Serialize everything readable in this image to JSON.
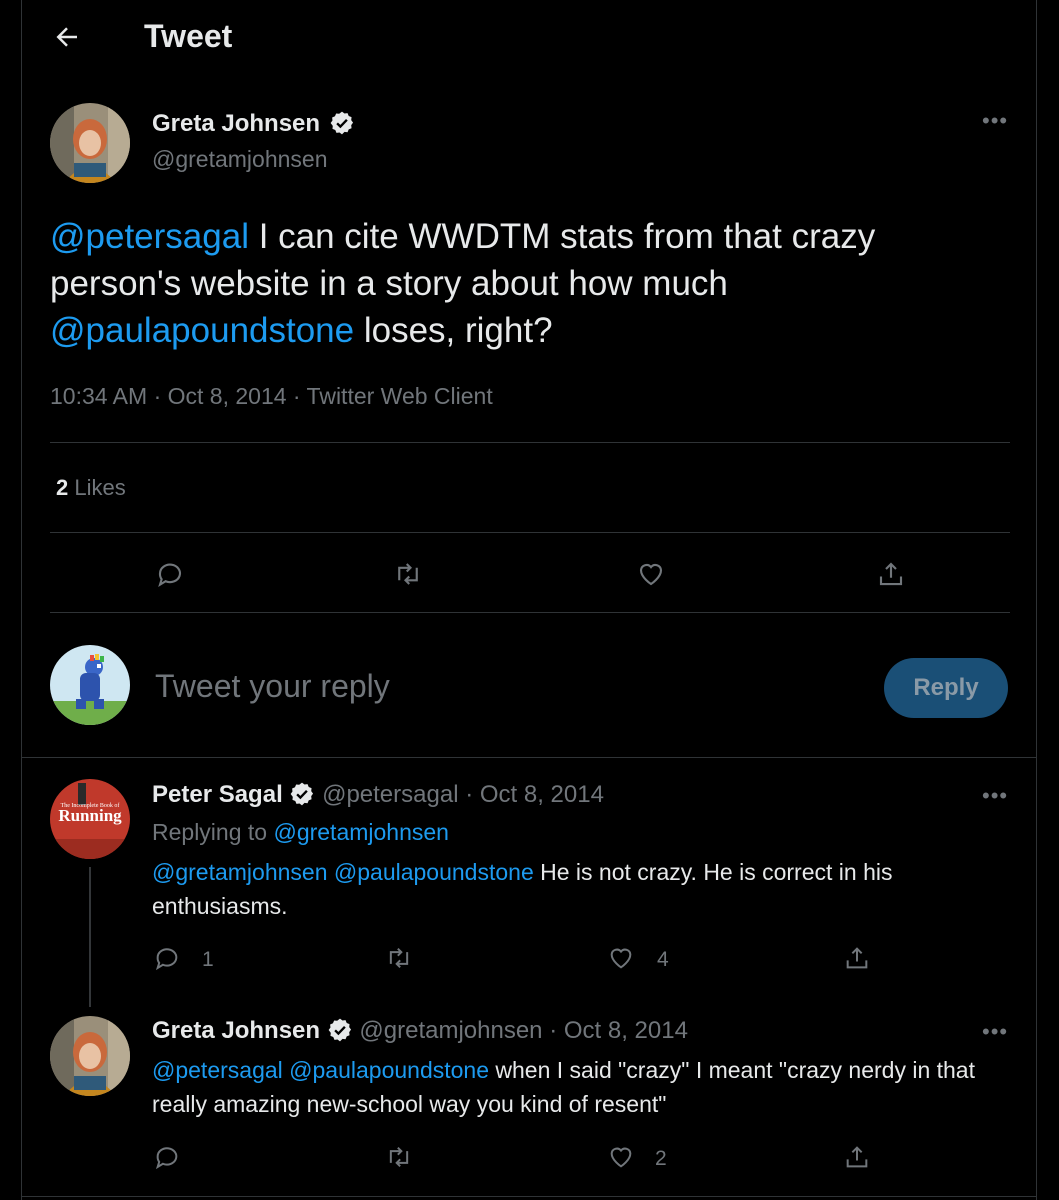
{
  "header": {
    "title": "Tweet"
  },
  "main_tweet": {
    "author_name": "Greta Johnsen",
    "author_handle": "@gretamjohnsen",
    "text_mention1": "@petersagal",
    "text_part1": " I can cite WWDTM stats from that crazy person's website in a story about how much ",
    "text_mention2": "@paulapoundstone",
    "text_part2": " loses, right?",
    "meta": "10:34 AM · Oct 8, 2014 · Twitter Web Client",
    "likes_count": "2",
    "likes_label": " Likes"
  },
  "composer": {
    "placeholder": "Tweet your reply",
    "reply_label": "Reply"
  },
  "replies": [
    {
      "author_name": "Peter Sagal",
      "author_meta": "@petersagal · Oct 8, 2014",
      "replying_prefix": "Replying to ",
      "replying_handle": "@gretamjohnsen",
      "mention1": "@gretamjohnsen",
      "mention2": "@paulapoundstone",
      "text": " He is not crazy. He is correct in his enthusiasms.",
      "reply_count": "1",
      "like_count": "4",
      "avatar_text_small": "The Incomplete Book of",
      "avatar_text_big": "Running"
    },
    {
      "author_name": "Greta Johnsen",
      "author_meta": "@gretamjohnsen · Oct 8, 2014",
      "mention1": "@petersagal",
      "mention2": "@paulapoundstone",
      "text": " when I said \"crazy\" I meant \"crazy nerdy in that really amazing new-school way you kind of resent\"",
      "like_count": "2"
    }
  ],
  "colors": {
    "background": "#000000",
    "text": "#e7e9ea",
    "muted": "#71767b",
    "link": "#1d9bf0",
    "reply_button": "#1a4f76"
  },
  "icons": [
    "back-arrow-icon",
    "verified-badge-icon",
    "more-icon",
    "reply-icon",
    "retweet-icon",
    "like-icon",
    "share-icon"
  ]
}
